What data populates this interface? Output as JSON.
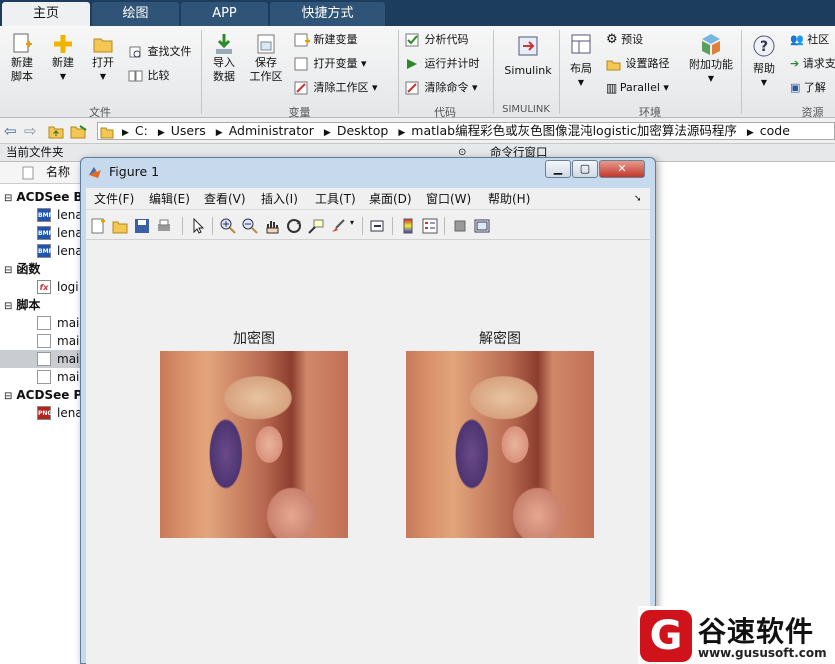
{
  "tabs": [
    "主页",
    "绘图",
    "APP",
    "快捷方式"
  ],
  "ribbon": {
    "file": {
      "new_script": "新建\n脚本",
      "new": "新建",
      "open": "打开",
      "find_files": "查找文件",
      "compare": "比较",
      "group": "文件"
    },
    "variable": {
      "import_data": "导入\n数据",
      "save_workspace": "保存\n工作区",
      "new_variable": "新建变量",
      "open_variable": "打开变量",
      "clear_workspace": "清除工作区",
      "group": "变量"
    },
    "code": {
      "analyze_code": "分析代码",
      "run_and_time": "运行并计时",
      "clear_commands": "清除命令",
      "group": "代码"
    },
    "simulink": {
      "label": "Simulink",
      "group": "SIMULINK"
    },
    "environment": {
      "layout": "布局",
      "preferences": "预设",
      "set_path": "设置路径",
      "parallel": "Parallel",
      "addons": "附加功能",
      "group": "环境"
    },
    "resources": {
      "help": "帮助",
      "community": "社区",
      "request_support": "请求支",
      "learn": "了解",
      "group": "资源"
    }
  },
  "address": {
    "path": [
      "C:",
      "Users",
      "Administrator",
      "Desktop",
      "matlab编程彩色或灰色图像混沌logistic加密算法源码程序",
      "code"
    ]
  },
  "left_panel": {
    "title": "当前文件夹",
    "column": "名称",
    "groups": [
      {
        "label": "ACDSee B",
        "items": [
          "lena",
          "lena",
          "lena"
        ],
        "icon": "bmp-file-icon",
        "badge": "BMP"
      },
      {
        "label": "函数",
        "items": [
          "logi"
        ],
        "icon": "function-file-icon",
        "badge": "fx"
      },
      {
        "label": "脚本",
        "items": [
          "mai",
          "mai",
          "mai",
          "mai"
        ],
        "icon": "script-file-icon",
        "badge": ""
      },
      {
        "label": "ACDSee P",
        "items": [
          "lena"
        ],
        "icon": "png-file-icon",
        "badge": "PNG"
      }
    ]
  },
  "command_window": {
    "title": "命令行窗口"
  },
  "figure": {
    "title": "Figure 1",
    "menu": [
      "文件(F)",
      "编辑(E)",
      "查看(V)",
      "插入(I)",
      "工具(T)",
      "桌面(D)",
      "窗口(W)",
      "帮助(H)"
    ],
    "encrypted_title": "加密图",
    "decrypted_title": "解密图"
  },
  "watermark": {
    "brand": "谷速软件",
    "url": "www.gususoft.com",
    "logo": "G"
  },
  "colors": {
    "tabstrip": "#1c3d5e",
    "ribbon_bg": "#e9ebed",
    "figure_frame": "#c7d9ec",
    "watermark_red": "#d0121b"
  }
}
